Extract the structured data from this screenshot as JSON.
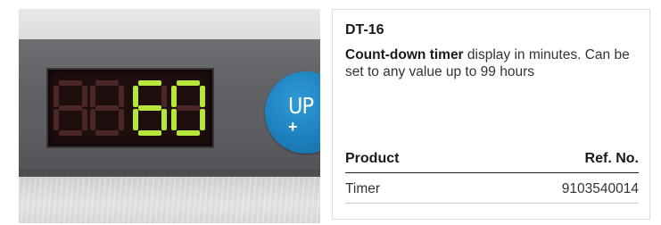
{
  "display": {
    "digits": [
      "8",
      "8",
      "6",
      "0"
    ],
    "lit": [
      false,
      false,
      true,
      true
    ],
    "lit_color": "#b6e63a",
    "dim_color": "#4a2628",
    "up_label": "UP",
    "up_plus": "+",
    "up_color": "#1c7fbd"
  },
  "product": {
    "model": "DT-16",
    "desc_bold": "Count-down timer",
    "desc_rest": " display in minutes. Can be set to any value up to 99 hours"
  },
  "table": {
    "headers": {
      "product": "Product",
      "ref": "Ref. No."
    },
    "rows": [
      {
        "product": "Timer",
        "ref": "9103540014"
      }
    ]
  }
}
